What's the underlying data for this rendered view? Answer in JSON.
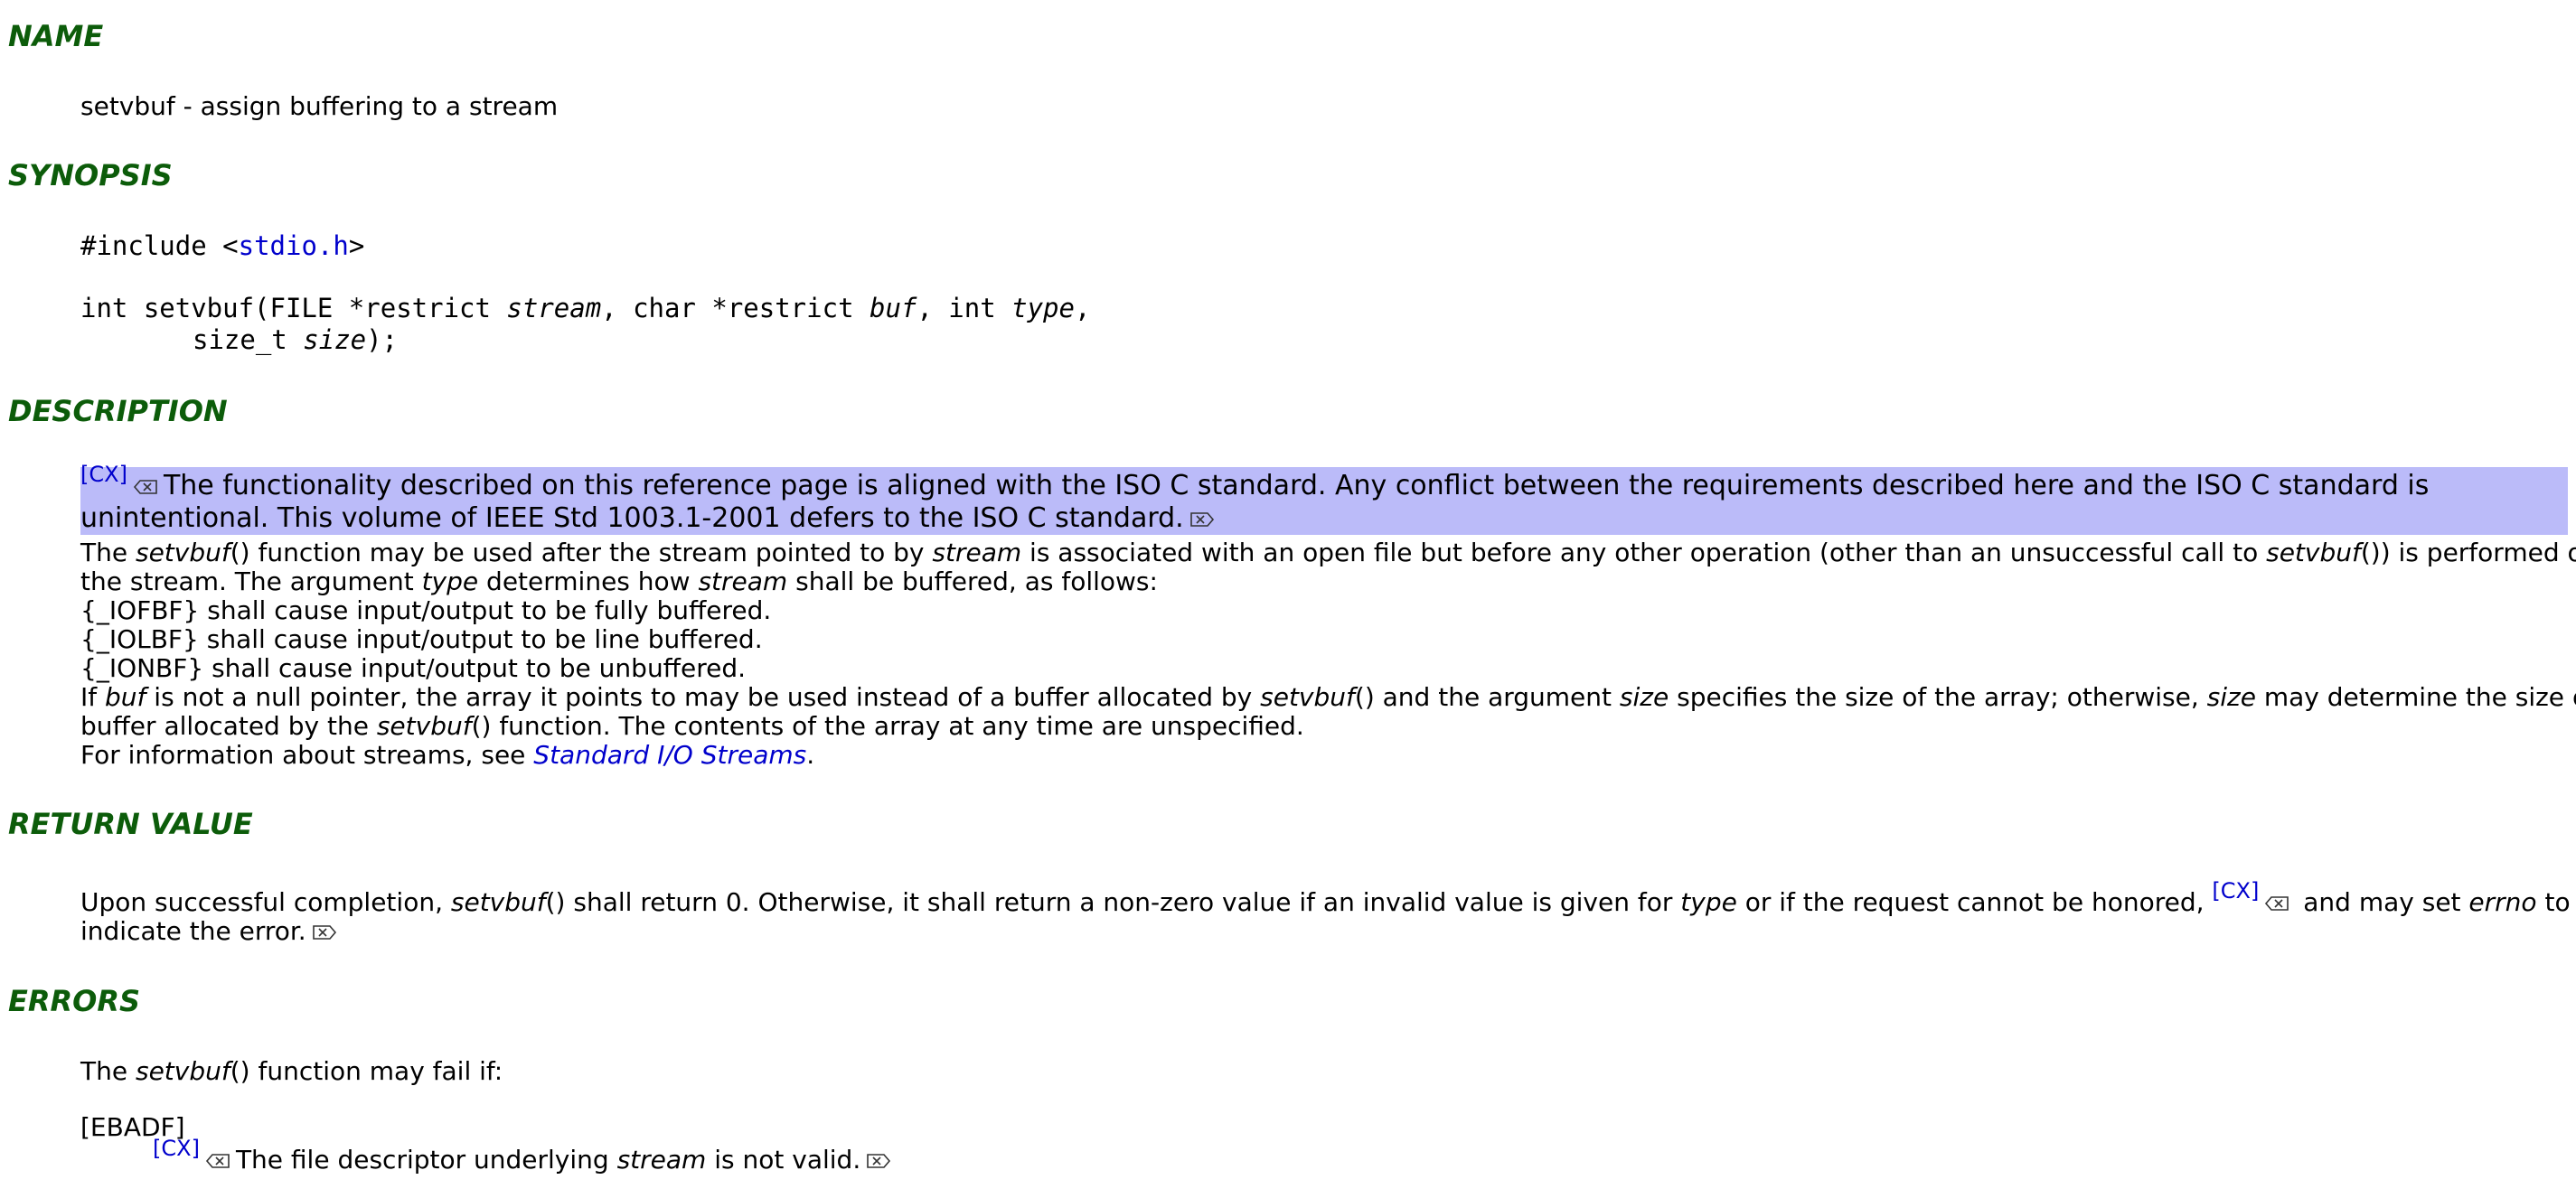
{
  "name": {
    "heading": "NAME",
    "summary": "setvbuf - assign buffering to a stream"
  },
  "synopsis": {
    "heading": "SYNOPSIS",
    "include_pre": "#include <",
    "include_link": "stdio.h",
    "include_post": ">",
    "sig_a": "int setvbuf(FILE *restrict ",
    "sig_stream": "stream",
    "sig_b": ", char *restrict ",
    "sig_buf": "buf",
    "sig_c": ", int ",
    "sig_type": "type",
    "sig_d": ",",
    "sig_e": "size_t ",
    "sig_size": "size",
    "sig_f": ");"
  },
  "description": {
    "heading": "DESCRIPTION",
    "cx_tag": "[CX]",
    "cx_line1": "The functionality described on this reference page is aligned with the ISO C standard. Any conflict between the requirements described here and the ISO C standard is",
    "cx_line2": "unintentional. This volume of IEEE Std 1003.1-2001 defers to the ISO C standard.",
    "p1_a": "The ",
    "p1_fn": "setvbuf",
    "p1_b": "() function may be used after the stream pointed to by ",
    "p1_stream": "stream",
    "p1_c": " is associated with an open file but before any other operation (other than an unsuccessful call to ",
    "p1_fn2": "setvbuf",
    "p1_d": "()) is performed on",
    "p2_a": "the stream. The argument ",
    "p2_type": "type",
    "p2_b": " determines how ",
    "p2_stream": "stream",
    "p2_c": " shall be buffered, as follows:",
    "iofbf": "{_IOFBF} shall cause input/output to be fully buffered.",
    "iolbf": "{_IOLBF} shall cause input/output to be line buffered.",
    "ionbf": "{_IONBF} shall cause input/output to be unbuffered.",
    "p3_a": "If ",
    "p3_buf": "buf",
    "p3_b": " is not a null pointer, the array it points to may be used instead of a buffer allocated by ",
    "p3_fn": "setvbuf",
    "p3_c": "() and the argument ",
    "p3_size": "size",
    "p3_d": " specifies the size of the array; otherwise, ",
    "p3_size2": "size",
    "p3_e": " may determine the size of a",
    "p4_a": "buffer allocated by the ",
    "p4_fn": "setvbuf",
    "p4_b": "() function. The contents of the array at any time are unspecified.",
    "p5_a": "For information about streams, see ",
    "p5_link": "Standard I/O Streams",
    "p5_b": "."
  },
  "return_value": {
    "heading": "RETURN VALUE",
    "l1_a": "Upon successful completion, ",
    "l1_fn": "setvbuf",
    "l1_b": "() shall return 0. Otherwise, it shall return a non-zero value if an invalid value is given for ",
    "l1_type": "type",
    "l1_c": " or if the request cannot be honored, ",
    "l1_cx": "[CX]",
    "l1_d": " and may set ",
    "l1_errno": "errno",
    "l1_e": " to",
    "l2": "indicate the error."
  },
  "errors": {
    "heading": "ERRORS",
    "intro_a": "The ",
    "intro_fn": "setvbuf",
    "intro_b": "() function may fail if:",
    "ebadf": "[EBADF]",
    "cx": "[CX]",
    "ebadf_a": "The file descriptor underlying ",
    "ebadf_stream": "stream",
    "ebadf_b": " is not valid."
  },
  "icons": {
    "cx_start": "cx-start-marker-icon",
    "cx_end": "cx-end-marker-icon"
  },
  "colors": {
    "heading": "#0c5c0a",
    "link": "#0000cc",
    "cx_shade": "#bbbbf9"
  }
}
